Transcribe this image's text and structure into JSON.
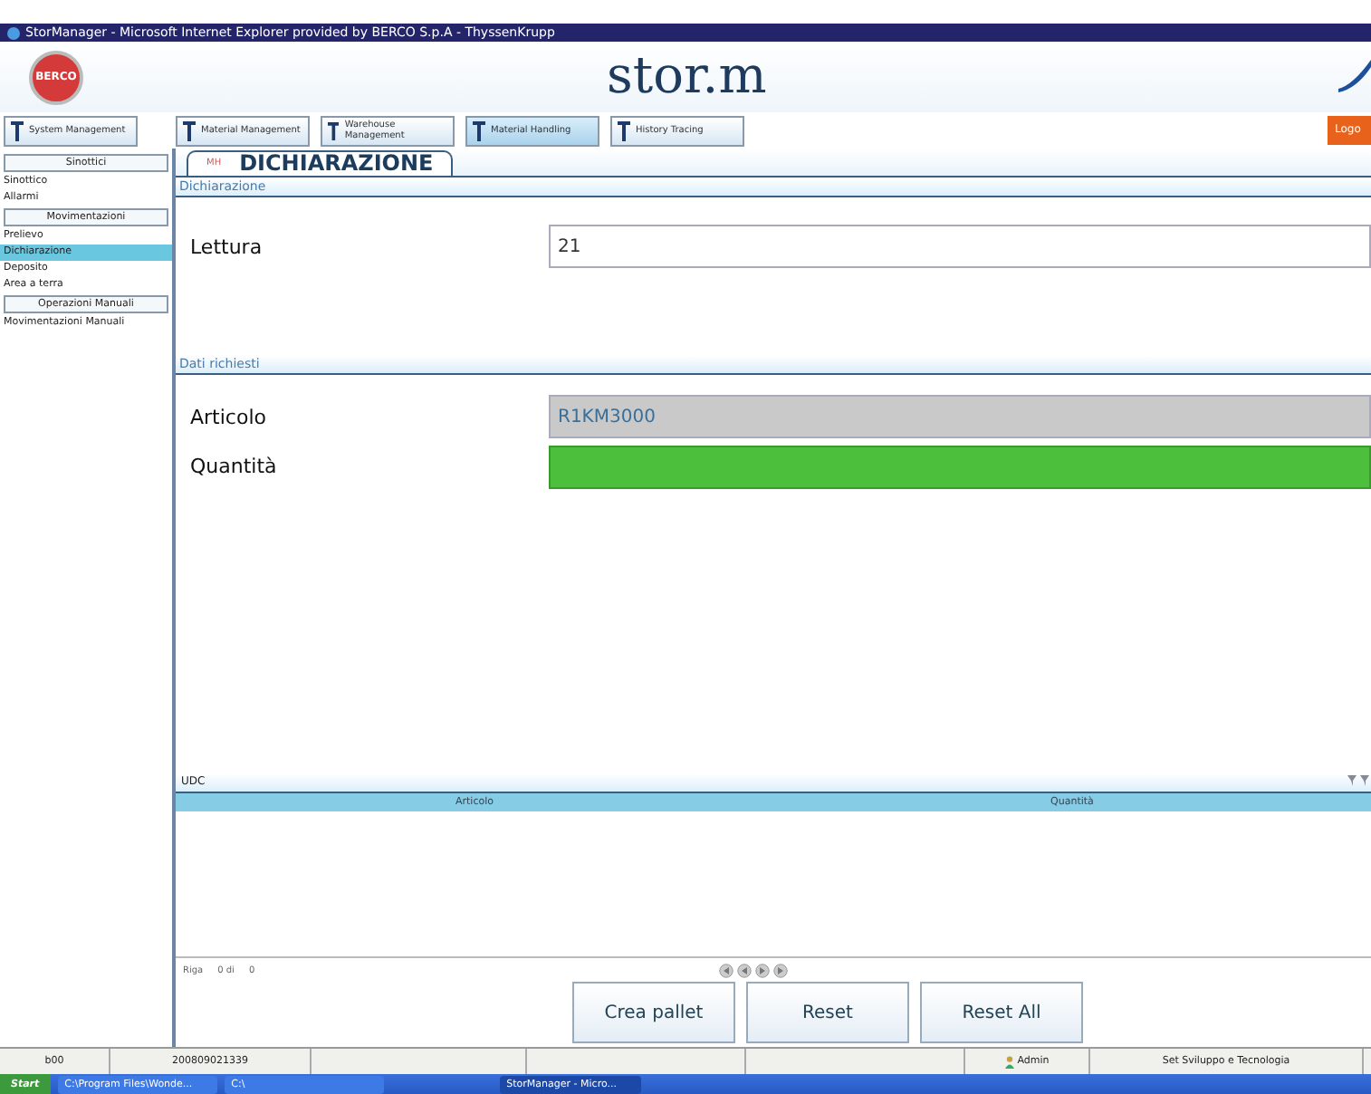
{
  "window": {
    "title": "StorManager - Microsoft Internet Explorer provided by BERCO S.p.A - ThyssenKrupp"
  },
  "header": {
    "logo_text": "BERCO",
    "app_name": "stor.m",
    "logout": "Logo"
  },
  "nav": [
    {
      "label": "System Management",
      "selected": false
    },
    {
      "label": "Material Management",
      "selected": false
    },
    {
      "label": "Warehouse Management",
      "selected": false
    },
    {
      "label": "Material Handling",
      "selected": true
    },
    {
      "label": "History Tracing",
      "selected": false
    }
  ],
  "sidebar": [
    {
      "kind": "header",
      "label": "Sinottici"
    },
    {
      "kind": "item",
      "label": "Sinottico",
      "selected": false
    },
    {
      "kind": "item",
      "label": "Allarmi",
      "selected": false
    },
    {
      "kind": "header",
      "label": "Movimentazioni"
    },
    {
      "kind": "item",
      "label": "Prelievo",
      "selected": false
    },
    {
      "kind": "item",
      "label": "Dichiarazione",
      "selected": true
    },
    {
      "kind": "item",
      "label": "Deposito",
      "selected": false
    },
    {
      "kind": "item",
      "label": "Area a terra",
      "selected": false
    },
    {
      "kind": "header",
      "label": "Operazioni Manuali"
    },
    {
      "kind": "item",
      "label": "Movimentazioni Manuali",
      "selected": false
    }
  ],
  "tab": {
    "code": "MH",
    "title": "DICHIARAZIONE"
  },
  "declaration": {
    "title": "Dichiarazione",
    "fields": [
      {
        "label": "Lettura",
        "value": "21",
        "kind": "input"
      }
    ]
  },
  "required": {
    "title": "Dati richiesti",
    "fields": [
      {
        "label": "Articolo",
        "value": "R1KM3000",
        "kind": "readonly"
      },
      {
        "label": "Quantità",
        "kind": "valid"
      }
    ]
  },
  "udc": {
    "title": "UDC",
    "columns": [
      "Articolo",
      "Quantità"
    ]
  },
  "pager": {
    "label": "Riga",
    "position": "0 di",
    "total": "0"
  },
  "buttons": [
    "Crea pallet",
    "Reset",
    "Reset All"
  ],
  "status_bar": [
    {
      "text": "b00"
    },
    {
      "text": "200809021339"
    },
    {
      "text": "Admin",
      "kind": "user"
    },
    {
      "text": "Set Sviluppo e Tecnologia"
    }
  ],
  "taskbar": {
    "start": "Start",
    "items": [
      {
        "label": "C:\\Program Files\\Wonde...",
        "selected": false
      },
      {
        "label": "C:\\",
        "selected": false
      },
      {
        "label": "StorManager - Micro...",
        "selected": true
      }
    ]
  }
}
